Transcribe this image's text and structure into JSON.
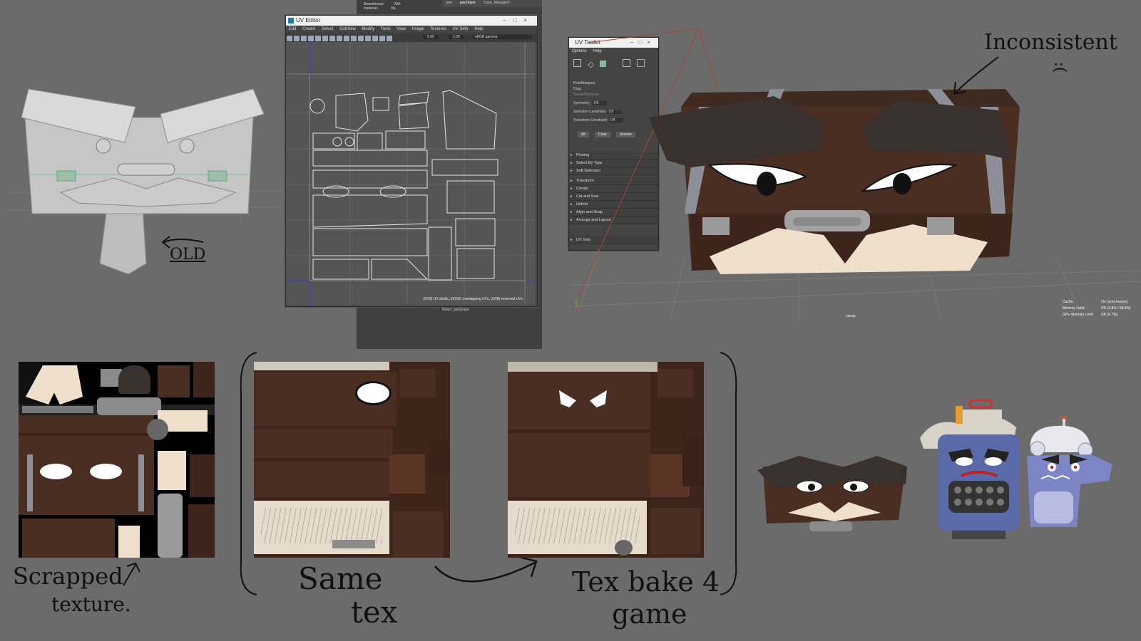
{
  "uv_editor": {
    "title": "UV Editor",
    "menu": [
      "Edit",
      "Create",
      "Select",
      "Cut/Sew",
      "Modify",
      "Tools",
      "View",
      "Image",
      "Textures",
      "UV Sets",
      "Help"
    ],
    "toolbar_value1": "0.00",
    "toolbar_value2": "1.00",
    "colorspace": "sRGB gamma",
    "status": "(0/33) UV shells, (0/192) overlapping UVs, (0/28) reversed UVs"
  },
  "attr_panel": {
    "rows": [
      {
        "label": "Smoothness:",
        "value": "N/A"
      },
      {
        "label": "Instance:",
        "value": "No"
      }
    ],
    "tabs": [
      "jaw",
      "jawShape",
      "Case_Manager1"
    ],
    "notes": "Notes:  jawShape"
  },
  "uv_toolkit": {
    "title": "UV Toolkit",
    "menu": [
      "Options",
      "Help"
    ],
    "pick_options": [
      "Pick/Marquee",
      "Drag",
      "Tweak/Marquee"
    ],
    "symmetry_label": "Symmetry:",
    "symmetry_value": "Off",
    "selection_label": "Selection Constraint:",
    "selection_value": "Off",
    "transform_label": "Transform Constraint:",
    "transform_value": "Off",
    "buttons": [
      "All",
      "Clear",
      "Inverse"
    ],
    "sections": [
      "Pinning",
      "Select By Type",
      "Soft Selection",
      "Transform",
      "Create",
      "Cut and Sew",
      "Unfold",
      "Align and Snap",
      "Arrange and Layout"
    ],
    "uv_sets": "UV Sets"
  },
  "viewport": {
    "camera": "persp",
    "hud": [
      {
        "label": "Cache:",
        "value": "On (sync+async)"
      },
      {
        "label": "Memory Limit:",
        "value": "OK (3.8% / 58.8%)"
      },
      {
        "label": "GPU Memory Limit:",
        "value": "OK (6.7%)"
      }
    ]
  },
  "annotations": {
    "old": "OLD",
    "inconsistent": "Inconsistent",
    "sad_face": ":(",
    "scrapped_line1": "Scrapped",
    "scrapped_line2": "texture.",
    "same_line1": "Same",
    "same_line2": "tex",
    "bake_line1": "Tex bake 4",
    "bake_line2": "game"
  },
  "colors": {
    "background": "#6b6b6b",
    "case_brown": "#4a2e22",
    "mustache": "#efe0cc",
    "robot_blue": "#5a6aa8",
    "maya_panel": "#444444"
  }
}
